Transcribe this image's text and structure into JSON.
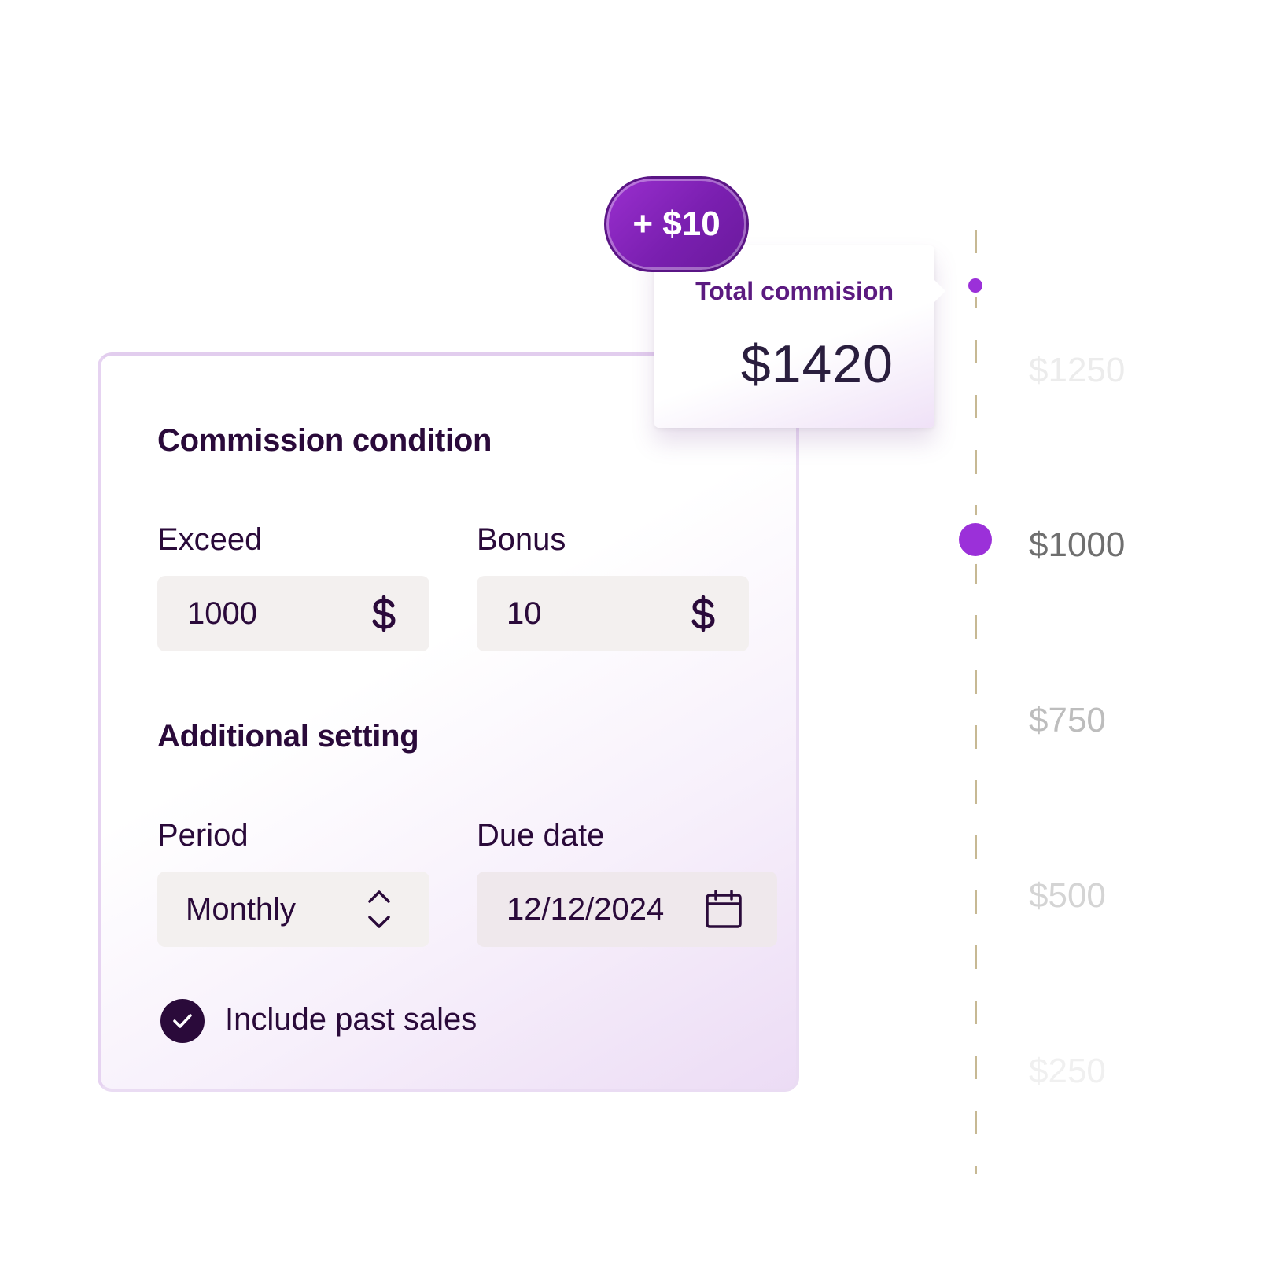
{
  "form": {
    "section1_title": "Commission condition",
    "exceed": {
      "label": "Exceed",
      "value": "1000",
      "icon": "dollar-icon"
    },
    "bonus": {
      "label": "Bonus",
      "value": "10",
      "icon": "dollar-icon"
    },
    "section2_title": "Additional setting",
    "period": {
      "label": "Period",
      "value": "Monthly",
      "icon": "chevron-up-down-icon"
    },
    "due_date": {
      "label": "Due date",
      "value": "12/12/2024",
      "icon": "calendar-icon"
    },
    "include_past_sales": {
      "label": "Include past sales",
      "checked": true
    }
  },
  "bonus_badge": {
    "text": "+ $10"
  },
  "tooltip": {
    "title": "Total commision",
    "value": "$1420"
  },
  "scale": {
    "ticks": [
      "$1250",
      "$1000",
      "$750",
      "$500",
      "$250"
    ],
    "active_tick": "$1000"
  },
  "colors": {
    "accent": "#9b30d9",
    "badge_purple": "#7a1fb0",
    "text_dark": "#2a0a3a",
    "field_bg": "#f3f0ef",
    "dash": "#c7b994"
  }
}
